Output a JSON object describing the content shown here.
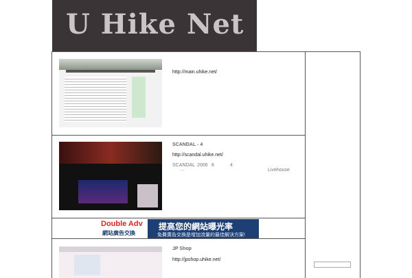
{
  "header": {
    "site_title": "U Hike Net"
  },
  "entries": [
    {
      "title": "",
      "url": "http://main.uhike.net/",
      "meta": []
    },
    {
      "title": "SCANDAL - 4",
      "url": "http://scandal.uhike.net/",
      "meta": [
        "SCANDAL",
        "2006",
        "8",
        "4",
        "Livehouse",
        "..."
      ]
    },
    {
      "title": "JP Shop",
      "url": "http://jpshop.uhike.net/",
      "meta": []
    }
  ],
  "banner": {
    "brand": "Double Adv",
    "brand_sub": "網站廣告交換",
    "headline": "提高您的網站曝光率",
    "tagline": "免費廣告交換是增加流量的最佳解決方案!"
  },
  "colors": {
    "header_bg": "#3b3437",
    "logo_text": "#c9c4c6",
    "banner_bg": "#1e3f73"
  }
}
